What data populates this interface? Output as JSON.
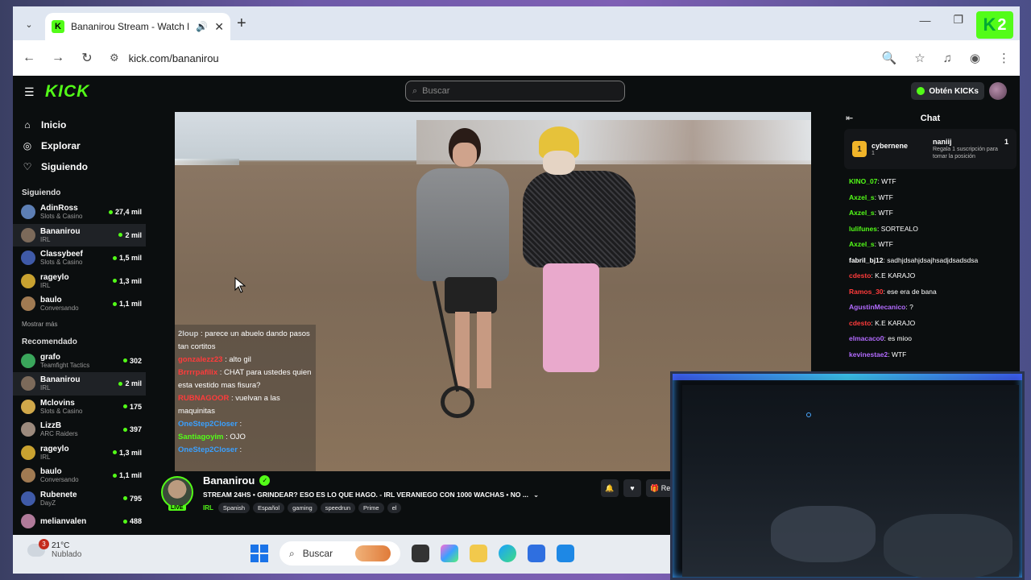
{
  "browser": {
    "tab_title": "Bananirou Stream - Watch l",
    "url": "kick.com/bananirou"
  },
  "kick": {
    "logo": "KICK",
    "search_placeholder": "Buscar",
    "get_kicks": "Obtén KICKs",
    "nav": [
      {
        "label": "Inicio",
        "icon": "home-icon"
      },
      {
        "label": "Explorar",
        "icon": "compass-icon"
      },
      {
        "label": "Siguiendo",
        "icon": "heart-icon"
      }
    ],
    "following_title": "Siguiendo",
    "following": [
      {
        "name": "AdinRoss",
        "category": "Slots & Casino",
        "viewers": "27,4 mil",
        "color": "#5d7fb5"
      },
      {
        "name": "Bananirou",
        "category": "IRL",
        "viewers": "2 mil",
        "color": "#7c6a5a",
        "active": true
      },
      {
        "name": "Classybeef",
        "category": "Slots & Casino",
        "viewers": "1,5 mil",
        "color": "#3f5aa8"
      },
      {
        "name": "rageylo",
        "category": "IRL",
        "viewers": "1,3 mil",
        "color": "#c9a230"
      },
      {
        "name": "baulo",
        "category": "Conversando",
        "viewers": "1,1 mil",
        "color": "#a07a52"
      }
    ],
    "show_more": "Mostrar más",
    "recommended_title": "Recomendado",
    "recommended": [
      {
        "name": "grafo",
        "category": "Teamfight Tactics",
        "viewers": "302",
        "color": "#3aa65b"
      },
      {
        "name": "Bananirou",
        "category": "IRL",
        "viewers": "2 mil",
        "color": "#7c6a5a",
        "active": true
      },
      {
        "name": "Mclovins",
        "category": "Slots & Casino",
        "viewers": "175",
        "color": "#d0a84a"
      },
      {
        "name": "LizzB",
        "category": "ARC Raiders",
        "viewers": "397",
        "color": "#9c8a7d"
      },
      {
        "name": "rageylo",
        "category": "IRL",
        "viewers": "1,3 mil",
        "color": "#c9a230"
      },
      {
        "name": "baulo",
        "category": "Conversando",
        "viewers": "1,1 mil",
        "color": "#a07a52"
      },
      {
        "name": "Rubenete",
        "category": "DayZ",
        "viewers": "795",
        "color": "#3f5aa8"
      },
      {
        "name": "melianvalen",
        "category": "",
        "viewers": "488",
        "color": "#b07a9a"
      }
    ]
  },
  "overlay_chat": [
    {
      "user": "2loup",
      "text": "parece un abuelo dando pasos tan cortitos",
      "color": "#cfcfcf"
    },
    {
      "user": "gonzalezz23",
      "text": "alto gil",
      "color": "#ff3b3b"
    },
    {
      "user": "Brrrrpafilix",
      "text": "CHAT para ustedes quien esta vestido mas fisura?",
      "color": "#ff3b3b"
    },
    {
      "user": "RUBNAGOOR",
      "text": "vuelvan a las maquinitas",
      "color": "#ff3b3b"
    },
    {
      "user": "OneStep2Closer",
      "text": "",
      "color": "#3aa0ff"
    },
    {
      "user": "Santiagoyim",
      "text": "OJO",
      "color": "#53fc18"
    },
    {
      "user": "OneStep2Closer",
      "text": "",
      "color": "#3aa0ff"
    }
  ],
  "chat": {
    "title": "Chat",
    "leader1_name": "cybernene",
    "leader1_count": "1",
    "leader2_name": "naniij",
    "leader2_count": "1",
    "leader_note": "Regala 1 suscripción para tomar la posición",
    "messages": [
      {
        "user": "KINO_07",
        "text": "WTF",
        "color": "#53fc18"
      },
      {
        "user": "Axzel_s",
        "text": "WTF",
        "color": "#53fc18"
      },
      {
        "user": "Axzel_s",
        "text": "WTF",
        "color": "#53fc18"
      },
      {
        "user": "lulifunes",
        "text": "SORTEALO",
        "color": "#53fc18"
      },
      {
        "user": "Axzel_s",
        "text": "WTF",
        "color": "#53fc18"
      },
      {
        "user": "fabril_bj12",
        "text": "sadhjdsahjdsajhsadjdsadsdsa",
        "color": "#ffffff"
      },
      {
        "user": "cdesto",
        "text": "K.E KARAJO",
        "color": "#ff3b3b"
      },
      {
        "user": "Ramos_30",
        "text": "ese era de bana",
        "color": "#ff3b3b"
      },
      {
        "user": "AgustinMecanico",
        "text": "?",
        "color": "#b36bff"
      },
      {
        "user": "cdesto",
        "text": "K.E KARAJO",
        "color": "#ff3b3b"
      },
      {
        "user": "elmacaco0",
        "text": "es mioo",
        "color": "#b36bff"
      },
      {
        "user": "kevinestae2",
        "text": "WTF",
        "color": "#b36bff"
      }
    ]
  },
  "stream": {
    "name": "Bananirou",
    "live": "LIVE",
    "title": "STREAM 24HS • GRINDEAR? ESO ES LO QUE HAGO. - IRL VERANIEGO CON 1000 WACHAS • NO ...",
    "category": "IRL",
    "tags": [
      "Spanish",
      "Español",
      "gaming",
      "speedrun",
      "Prime",
      "el"
    ],
    "action_label": "Re"
  },
  "taskbar": {
    "temp": "21°C",
    "weather": "Nublado",
    "badge": "3",
    "search": "Buscar"
  },
  "overlay_badge": "K2"
}
